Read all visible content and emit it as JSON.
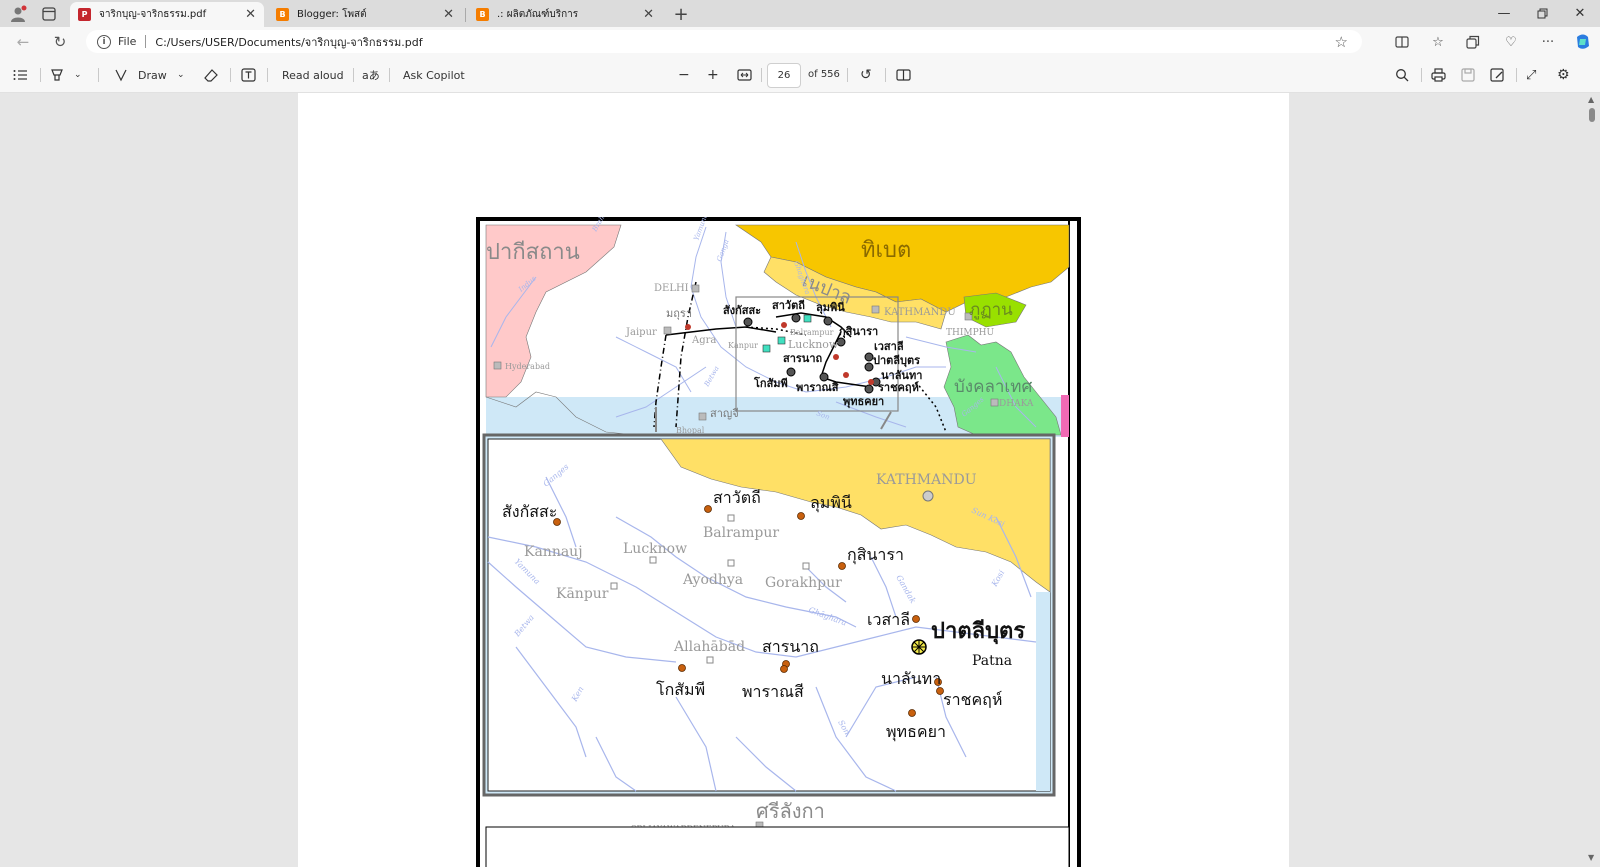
{
  "tabs": [
    {
      "title": "จาริกบุญ-จาริกธรรม.pdf",
      "favicon": "pdf-icon",
      "active": true
    },
    {
      "title": "Blogger: โพสต์",
      "favicon": "blogger-icon",
      "active": false
    },
    {
      "title": ".: ผลิตภัณฑ์บริการ",
      "favicon": "blogger-icon",
      "active": false
    }
  ],
  "address": {
    "scheme_label": "File",
    "url": "C:/Users/USER/Documents/จาริกบุญ-จาริกธรรม.pdf"
  },
  "toolbar": {
    "draw_label": "Draw",
    "read_aloud_label": "Read aloud",
    "text_options_label": "aあ",
    "copilot_label": "Ask Copilot",
    "page_number": "26",
    "page_total": "of 556"
  },
  "map": {
    "top": {
      "pakistan": "ปากีสถาน",
      "tibet": "ทิเบต",
      "nepal": "เนปาล",
      "bhutan": "ภูฏาน",
      "bangladesh": "บังคลาเทศ",
      "sri_lanka": "ศรีลังกา",
      "delhi": "DELHI",
      "mathura": "มถุรา",
      "jaipur": "Jaipur",
      "agra": "Agra",
      "hyderabad": "Hyderabad",
      "sanchi": "สาญจี",
      "bhopal": "Bhopal",
      "sankassa": "สังกัสสะ",
      "savatthi": "สาวัตถี",
      "lumbini": "ลุมพินี",
      "kathmandu": "KATHMANDU",
      "thimphu": "THIMPHU",
      "balrampur": "Balrampur",
      "kusinara": "กุสินารา",
      "kanpur": "Kanpur",
      "lucknow": "Lucknow",
      "vesali": "เวสาลี",
      "sarnath": "สารนาถ",
      "pataliputra": "ปาตลีบุตร",
      "kosambi": "โกสัมพี",
      "varanasi": "พาราณสี",
      "nalanda": "นาลันทา",
      "rajagaha": "ราชคฤห์",
      "bodhgaya": "พุทธคยา",
      "dhaka": "DHAKA",
      "sri_jaya": "SRI JAYAWARDENEPURA",
      "yamuna": "Yamuna",
      "ganga": "Ganga",
      "ghaghara": "Ghaghara",
      "indus": "Indus",
      "betwa": "Betwa",
      "son": "Son",
      "ganges": "Ganges",
      "brahmaputra": "Brahmaputra"
    },
    "inset": {
      "sankassa": "สังกัสสะ",
      "savatthi": "สาวัตถี",
      "lumbini": "ลุมพินี",
      "kathmandu": "KATHMANDU",
      "balrampur": "Balrampur",
      "kannauj": "Kannauj",
      "lucknow": "Lucknow",
      "kusinara": "กุสินารา",
      "ayodhya": "Ayodhya",
      "gorakhpur": "Gorakhpur",
      "kanpur": "Kānpur",
      "vesali": "เวสาลี",
      "pataliputra": "ปาตลีบุตร",
      "patna": "Patna",
      "allahabad": "Allahābād",
      "sarnath": "สารนาถ",
      "kosambi": "โกสัมพี",
      "varanasi": "พาราณสี",
      "nalanda": "นาลันทา",
      "rajagaha": "ราชคฤห์",
      "bodhgaya": "พุทธคยา",
      "ganges": "Ganges",
      "yamuna": "Yamuna",
      "ghaghara": "Ghāghara",
      "gandak": "Gandak",
      "kosi": "Kosi",
      "sun_kosi": "Sun Kosi",
      "betwa": "Betwa",
      "ken": "Ken",
      "son": "Son"
    }
  },
  "colors": {
    "tibet": "#f7c600",
    "nepal": "#ffe066",
    "bhutan": "#99e000",
    "bangladesh": "#7be78a",
    "pakistan": "#ffc9c9",
    "sea": "#cfe8f7",
    "river": "#a8b6ec",
    "site": "#c8600e"
  }
}
